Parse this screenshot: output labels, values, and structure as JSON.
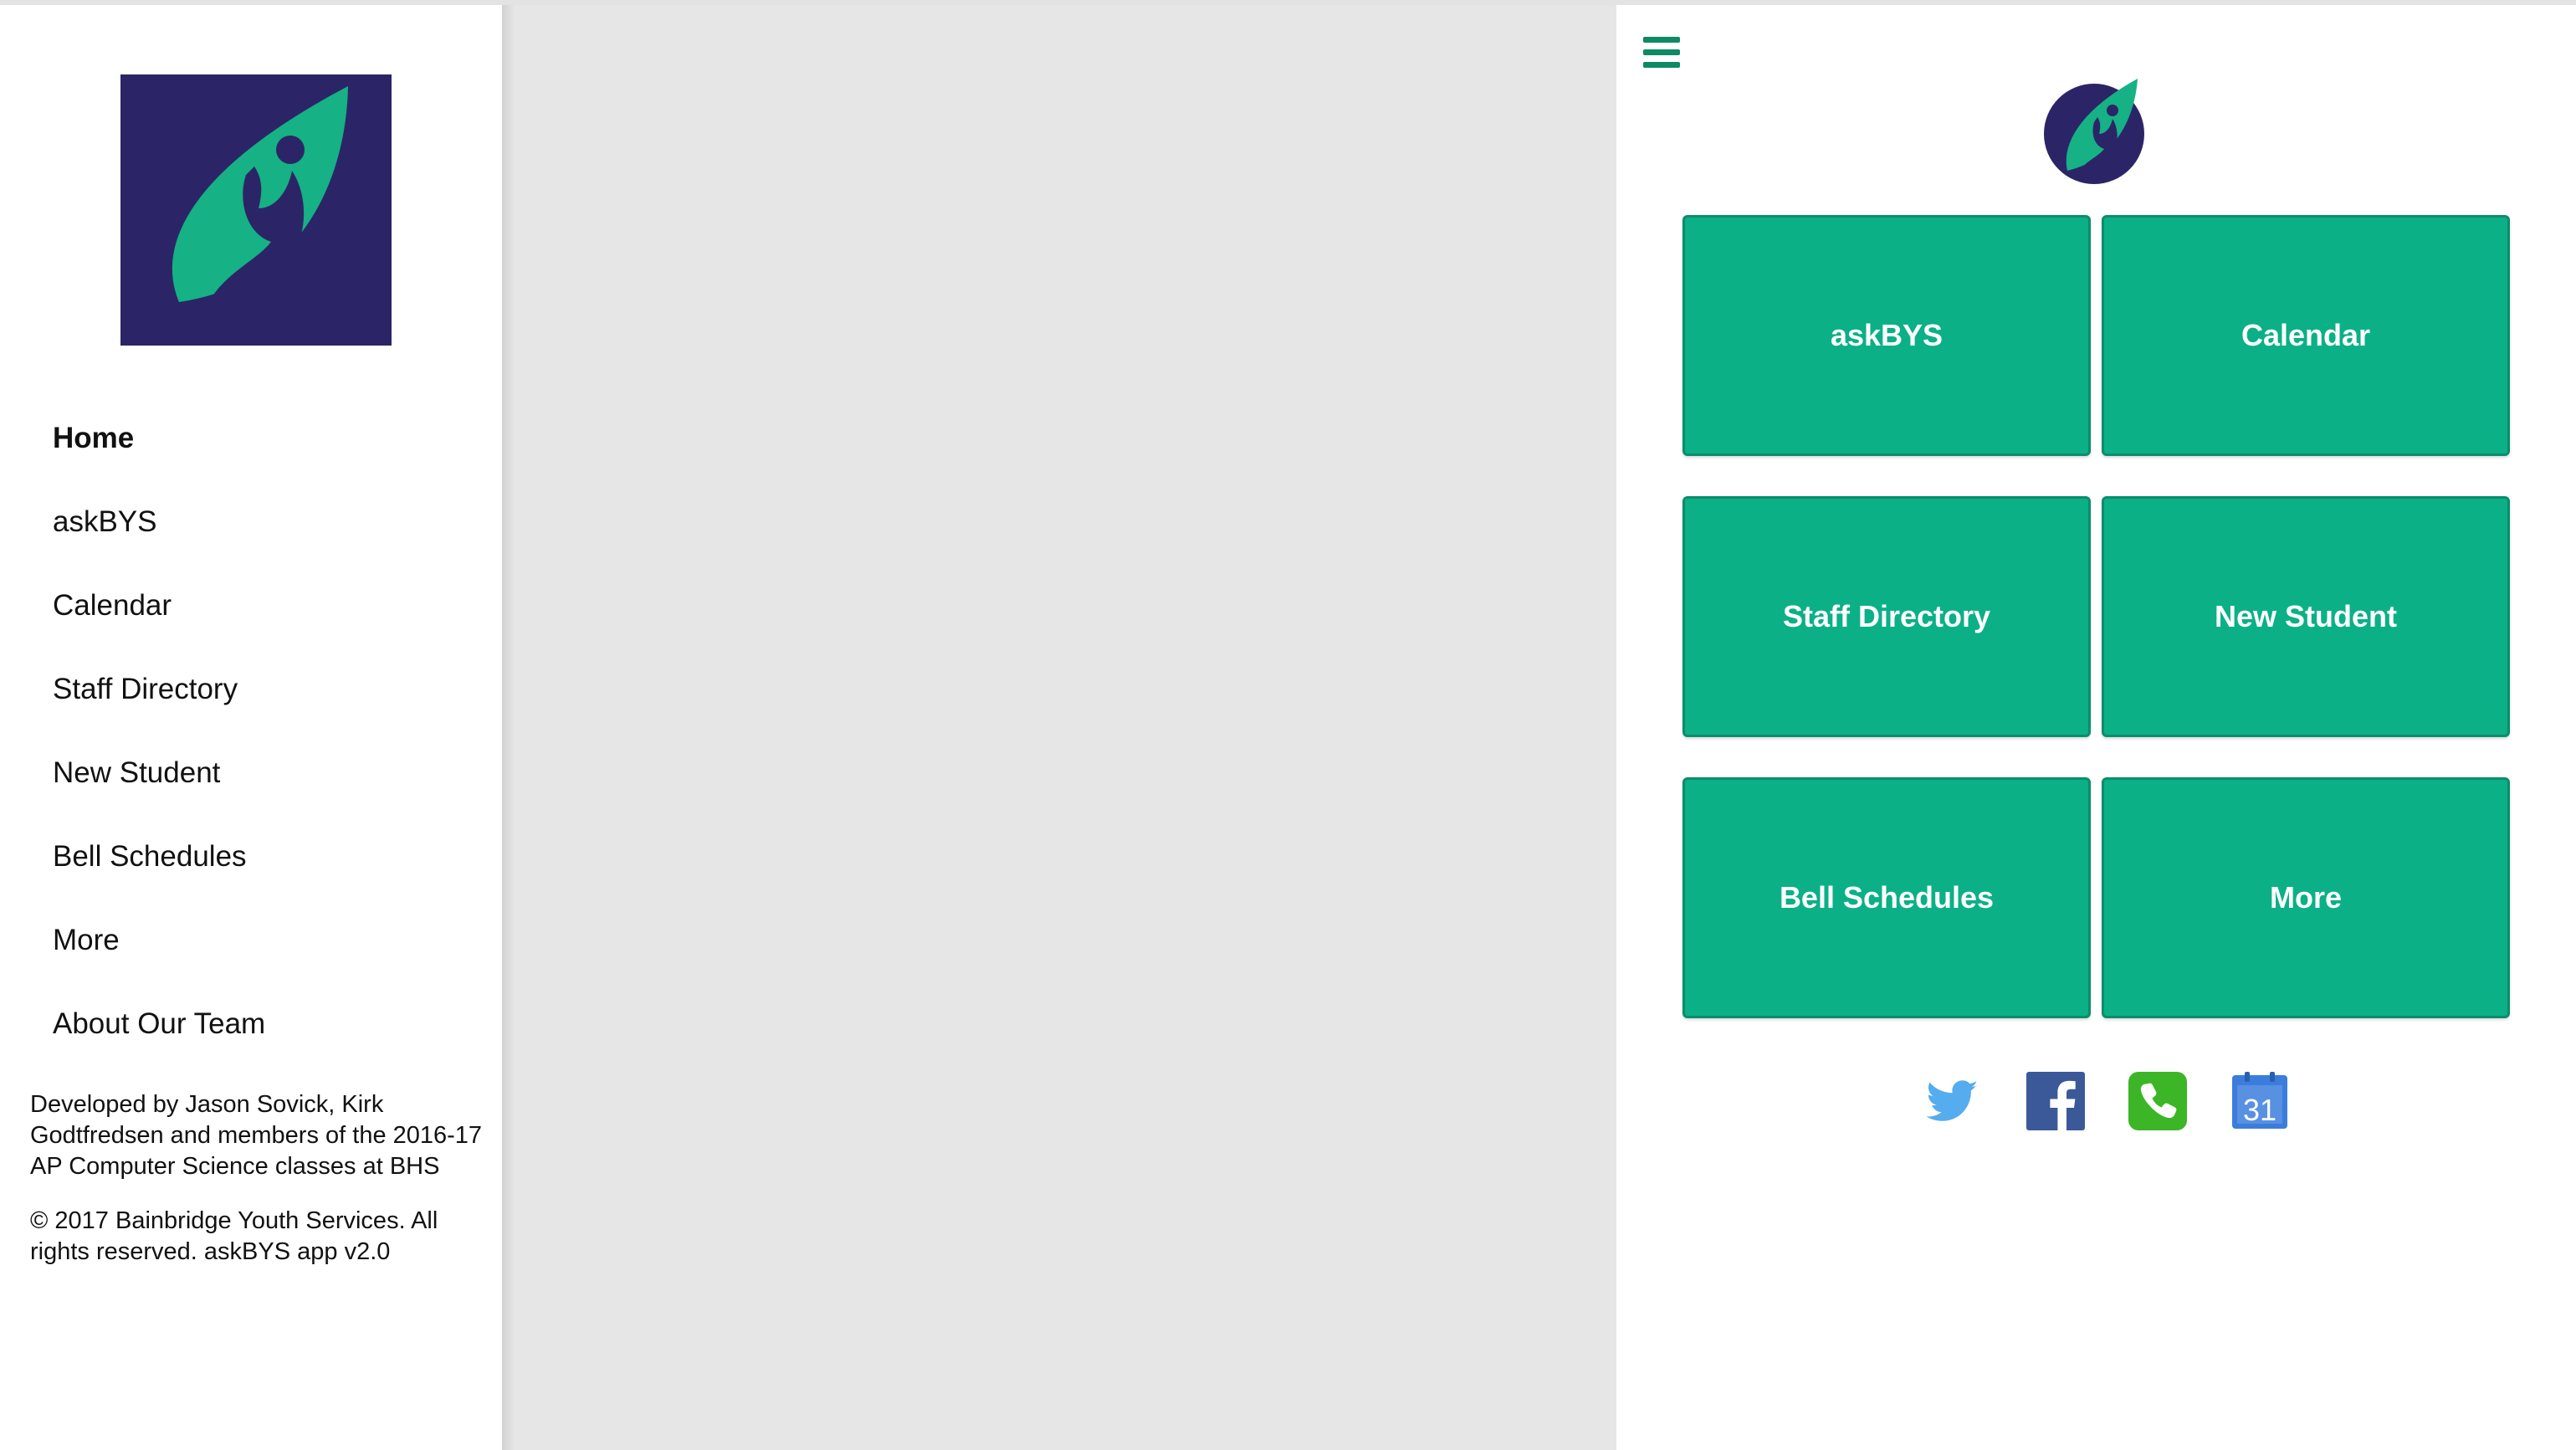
{
  "drawer": {
    "logo": "leaf-person-logo",
    "nav": [
      {
        "label": "Home",
        "active": true
      },
      {
        "label": "askBYS",
        "active": false
      },
      {
        "label": "Calendar",
        "active": false
      },
      {
        "label": "Staff Directory",
        "active": false
      },
      {
        "label": "New Student",
        "active": false
      },
      {
        "label": "Bell Schedules",
        "active": false
      },
      {
        "label": "More",
        "active": false
      },
      {
        "label": "About Our Team",
        "active": false
      }
    ],
    "credits": "Developed by Jason Sovick, Kirk Godtfredsen and members of the 2016-17 AP Computer Science classes at BHS",
    "copyright": "© 2017 Bainbridge Youth Services. All rights reserved. askBYS app v2.0"
  },
  "main": {
    "menu_icon": "hamburger-icon",
    "tiles": [
      {
        "label": "askBYS"
      },
      {
        "label": "Calendar"
      },
      {
        "label": "Staff Directory"
      },
      {
        "label": "New Student"
      },
      {
        "label": "Bell Schedules"
      },
      {
        "label": "More"
      }
    ],
    "social_icons": [
      "twitter-icon",
      "facebook-icon",
      "phone-icon",
      "google-calendar-icon"
    ],
    "calendar_icon_text": "31"
  },
  "colors": {
    "brand_green": "#0bb087",
    "brand_navy": "#2b2567",
    "scrim": "#e6e6e6"
  }
}
